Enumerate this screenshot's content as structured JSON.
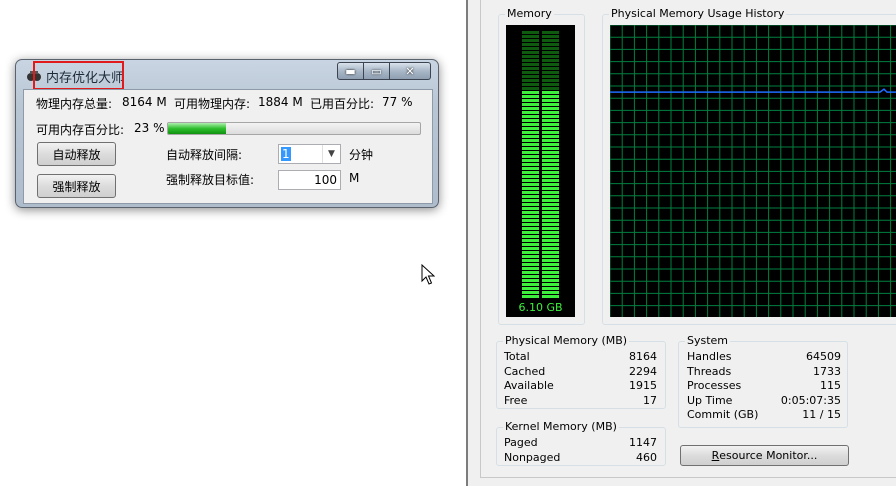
{
  "optimizer": {
    "title": "内存优化大师",
    "total_label": "物理内存总量:",
    "total_value": "8164 M",
    "avail_label": "可用物理内存:",
    "avail_value": "1884 M",
    "used_label": "已用百分比:",
    "used_value": "77 %",
    "avail_pct_label": "可用内存百分比:",
    "avail_pct_value": "23 %",
    "avail_pct": 23,
    "auto_release_button": "自动释放",
    "force_release_button": "强制释放",
    "interval_label": "自动释放间隔:",
    "interval_value": "1",
    "interval_unit": "分钟",
    "target_label": "强制释放目标值:",
    "target_value": "100",
    "target_unit": "M",
    "min_glyph": "▬",
    "max_glyph": "▭",
    "close_glyph": "✕"
  },
  "taskmgr": {
    "memory_title": "Memory",
    "memory_usage": "6.10 GB",
    "memory_used_fraction": 0.77,
    "history_title": "Physical Memory Usage History",
    "history_level_fraction": 0.77,
    "physical_memory": {
      "title": "Physical Memory (MB)",
      "rows": [
        {
          "label": "Total",
          "value": "8164"
        },
        {
          "label": "Cached",
          "value": "2294"
        },
        {
          "label": "Available",
          "value": "1915"
        },
        {
          "label": "Free",
          "value": "17"
        }
      ]
    },
    "kernel_memory": {
      "title": "Kernel Memory (MB)",
      "rows": [
        {
          "label": "Paged",
          "value": "1147"
        },
        {
          "label": "Nonpaged",
          "value": "460"
        }
      ]
    },
    "system": {
      "title": "System",
      "rows": [
        {
          "label": "Handles",
          "value": "64509"
        },
        {
          "label": "Threads",
          "value": "1733"
        },
        {
          "label": "Processes",
          "value": "115"
        },
        {
          "label": "Up Time",
          "value": "0:05:07:35"
        },
        {
          "label": "Commit (GB)",
          "value": "11 / 15"
        }
      ]
    },
    "resource_monitor_button": {
      "accel": "R",
      "rest": "esource Monitor..."
    }
  },
  "colors": {
    "meter_green": "#3cf03c",
    "grid_green": "#008040",
    "history_line": "#1e6cff",
    "highlight_red": "#e11b1b"
  }
}
